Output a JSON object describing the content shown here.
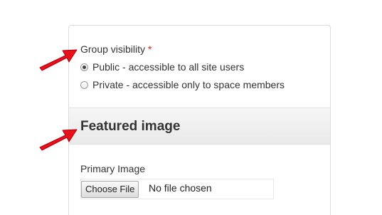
{
  "visibility": {
    "label": "Group visibility",
    "required_marker": "*",
    "options": [
      {
        "label": "Public - accessible to all site users",
        "checked": true
      },
      {
        "label": "Private - accessible only to space members",
        "checked": false
      }
    ]
  },
  "featured_image": {
    "section_title": "Featured image",
    "primary_label": "Primary Image",
    "choose_button": "Choose File",
    "file_status": "No file chosen"
  },
  "annotations": {
    "arrow_color": "#e8101a",
    "arrow_icon": "red-pointer-arrow-icon"
  }
}
